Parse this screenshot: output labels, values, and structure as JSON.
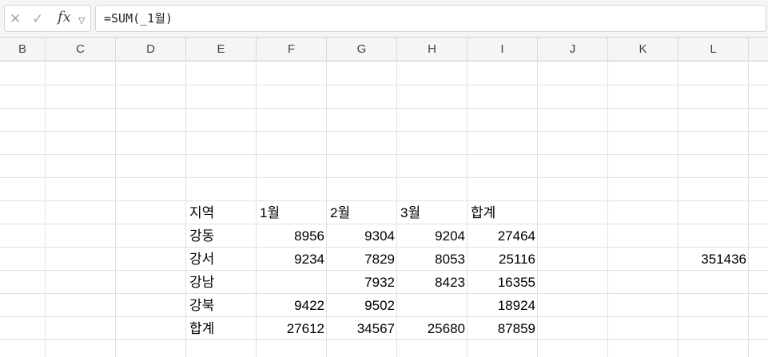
{
  "formula_bar": {
    "formula": "=SUM(_1월)",
    "icons": [
      "cancel-icon",
      "enter-icon",
      "function-icon",
      "chevron-down-icon"
    ]
  },
  "columns": [
    "B",
    "C",
    "D",
    "E",
    "F",
    "G",
    "H",
    "I",
    "J",
    "K",
    "L"
  ],
  "table": {
    "headers": [
      "지역",
      "1월",
      "2월",
      "3월",
      "합계"
    ],
    "rows": [
      {
        "region": "강동",
        "m1": "8956",
        "m2": "9304",
        "m3": "9204",
        "total": "27464"
      },
      {
        "region": "강서",
        "m1": "9234",
        "m2": "7829",
        "m3": "8053",
        "total": "25116"
      },
      {
        "region": "강남",
        "m1": "",
        "m2": "7932",
        "m3": "8423",
        "total": "16355"
      },
      {
        "region": "강북",
        "m1": "9422",
        "m2": "9502",
        "m3": "",
        "total": "18924"
      },
      {
        "region": "합계",
        "m1": "27612",
        "m2": "34567",
        "m3": "25680",
        "total": "87859"
      }
    ]
  },
  "side_value": "351436"
}
